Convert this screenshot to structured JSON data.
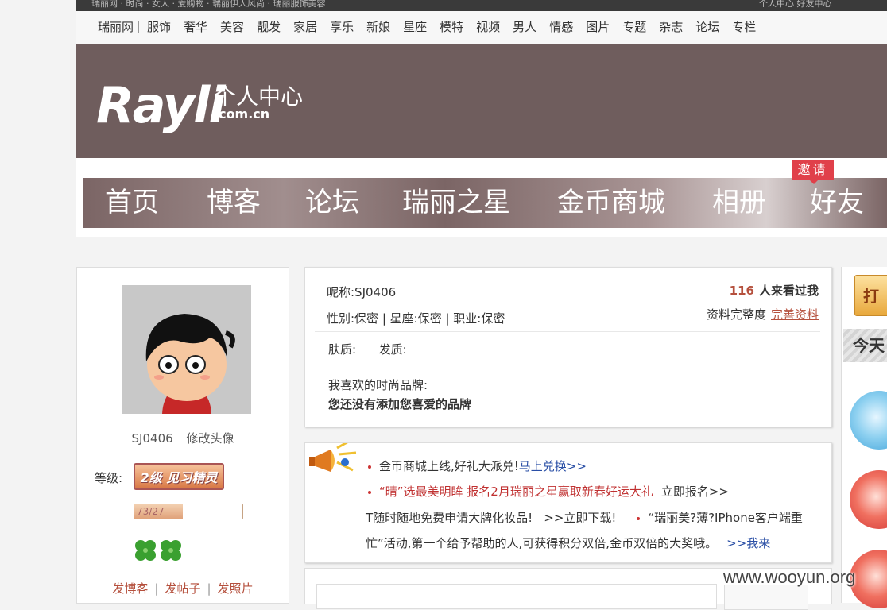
{
  "topbar": {
    "left_text": "瑞丽网 · 时尚 · 女人 · 爱购物 · 瑞丽伊人风尚 · 瑞丽服饰美容",
    "right_text": "个人中心  好友中心"
  },
  "nav": {
    "items": [
      "瑞丽网",
      "服饰",
      "奢华",
      "美容",
      "靓发",
      "家居",
      "享乐",
      "新娘",
      "星座",
      "模特",
      "视频",
      "男人",
      "情感",
      "图片",
      "专题",
      "杂志",
      "论坛",
      "专栏"
    ]
  },
  "logo": {
    "brand": "Rayli",
    "title": "个人中心",
    "domain": ".com.cn"
  },
  "main_menu": {
    "items": [
      "首页",
      "博客",
      "论坛",
      "瑞丽之星",
      "金币商城",
      "相册",
      "好友"
    ],
    "invite_badge": "邀请"
  },
  "profile": {
    "username": "SJ0406",
    "edit_avatar": "修改头像",
    "level_label": "等级:",
    "level_badge": "2级 见习精灵",
    "exp_text": "73/27",
    "exp_fraction": 0.45,
    "links": [
      "发博客",
      "发帖子",
      "发照片"
    ]
  },
  "info": {
    "nickname": "昵称:SJ0406",
    "visits_count": "116",
    "visits_text": "人来看过我",
    "attributes": "性别:保密 | 星座:保密 | 职业:保密",
    "completeness_label": "资料完整度",
    "complete_link": "完善资料",
    "skin_hair": "肤质:      发质:",
    "fav_brand_label": "我喜欢的时尚品牌:",
    "fav_brand_empty": "您还没有添加您喜爱的品牌"
  },
  "news": {
    "line1_text": "金币商城上线,好礼大派兑!",
    "line1_link": "马上兑换>>",
    "line2_text": "“晴”选最美明眸 报名2月瑞丽之星赢取新春好运大礼",
    "line2_link": "立即报名>>",
    "line3_text": "T随时随地免费申请大牌化妆品!",
    "line3_link": ">>立即下载!",
    "line3_tail": "“瑞丽美?薄?IPhone客户端重",
    "line4_text": "忙”活动,第一个给予帮助的人,可获得积分双倍,金币双倍的大奖哦。",
    "line4_link": ">>我来"
  },
  "right_sidebar": {
    "button_label": "打",
    "today_label": "今天"
  },
  "watermark": "www.wooyun.org",
  "colors": {
    "banner": "#6f5d5d",
    "accent": "#b5503d",
    "invite": "#e0404a",
    "link_blue": "#2a4fa6"
  }
}
